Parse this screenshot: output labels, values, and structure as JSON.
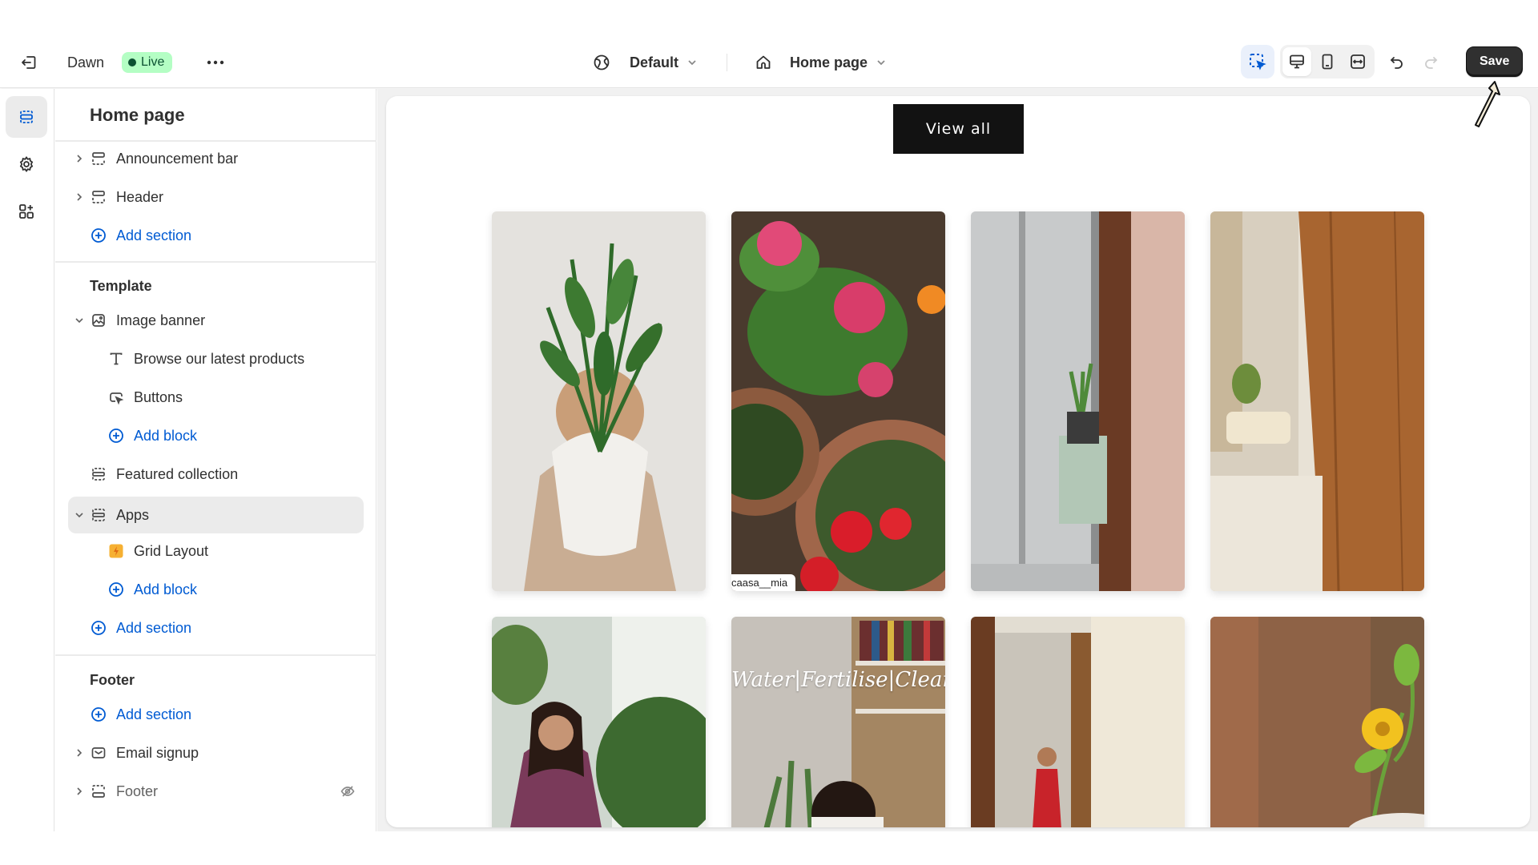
{
  "topbar": {
    "exit_icon": "exit-icon",
    "theme_name": "Dawn",
    "status_badge": "Live",
    "more_icon": "ellipsis-icon",
    "theme_selector": {
      "icon": "globe-icon",
      "label": "Default"
    },
    "page_selector": {
      "icon": "home-icon",
      "label": "Home page"
    },
    "tools": {
      "inspector": "inspector-select-icon",
      "desktop": "desktop-icon",
      "mobile": "mobile-icon",
      "fullwidth": "full-width-icon",
      "undo": "undo-icon",
      "redo": "redo-icon"
    },
    "save_label": "Save"
  },
  "rail": {
    "items": [
      {
        "name": "sections",
        "icon": "sections-icon",
        "active": true
      },
      {
        "name": "theme-settings",
        "icon": "gear-icon",
        "active": false
      },
      {
        "name": "app-embeds",
        "icon": "apps-add-icon",
        "active": false
      }
    ]
  },
  "panel": {
    "title": "Home page",
    "header_group": [
      {
        "label": "Announcement bar",
        "icon": "section-icon",
        "expandable": true
      },
      {
        "label": "Header",
        "icon": "section-icon",
        "expandable": true
      },
      {
        "label": "Add section",
        "icon": "plus-circle-icon",
        "link": true
      }
    ],
    "template_title": "Template",
    "template_group": [
      {
        "label": "Image banner",
        "icon": "image-icon",
        "expanded": true,
        "level": 0
      },
      {
        "label": "Browse our latest products",
        "icon": "text-icon",
        "level": 1
      },
      {
        "label": "Buttons",
        "icon": "button-icon",
        "level": 1
      },
      {
        "label": "Add block",
        "icon": "plus-circle-icon",
        "link": true,
        "level": 1
      },
      {
        "label": "Featured collection",
        "icon": "section-icon",
        "level": 0
      },
      {
        "label": "Apps",
        "icon": "section-icon",
        "expanded": true,
        "selected": true,
        "level": 0
      },
      {
        "label": "Grid Layout",
        "icon": "app-bolt-icon",
        "level": 1
      },
      {
        "label": "Add block",
        "icon": "plus-circle-icon",
        "link": true,
        "level": 1
      },
      {
        "label": "Add section",
        "icon": "plus-circle-icon",
        "link": true,
        "level": 0
      }
    ],
    "footer_title": "Footer",
    "footer_group": [
      {
        "label": "Add section",
        "icon": "plus-circle-icon",
        "link": true
      },
      {
        "label": "Email signup",
        "icon": "email-icon",
        "expandable": true
      },
      {
        "label": "Footer",
        "icon": "footer-icon",
        "expandable": true,
        "hidden": true,
        "trail_icon": "eye-hidden-icon"
      }
    ]
  },
  "preview": {
    "view_all_label": "View all",
    "tiles": [
      {
        "subject": "woman holding plant",
        "caption": ""
      },
      {
        "subject": "flower pots",
        "caption": "caasa__mia"
      },
      {
        "subject": "bathroom glass door",
        "caption": ""
      },
      {
        "subject": "wood panel living room",
        "caption": ""
      },
      {
        "subject": "woman laughing with plants",
        "caption": ""
      },
      {
        "subject": "bookshelf plants",
        "caption": "",
        "overlay_text": "Water|Fertilise|Clean"
      },
      {
        "subject": "woman in red dress doorway",
        "caption": ""
      },
      {
        "subject": "yellow flower",
        "caption": ""
      }
    ]
  }
}
